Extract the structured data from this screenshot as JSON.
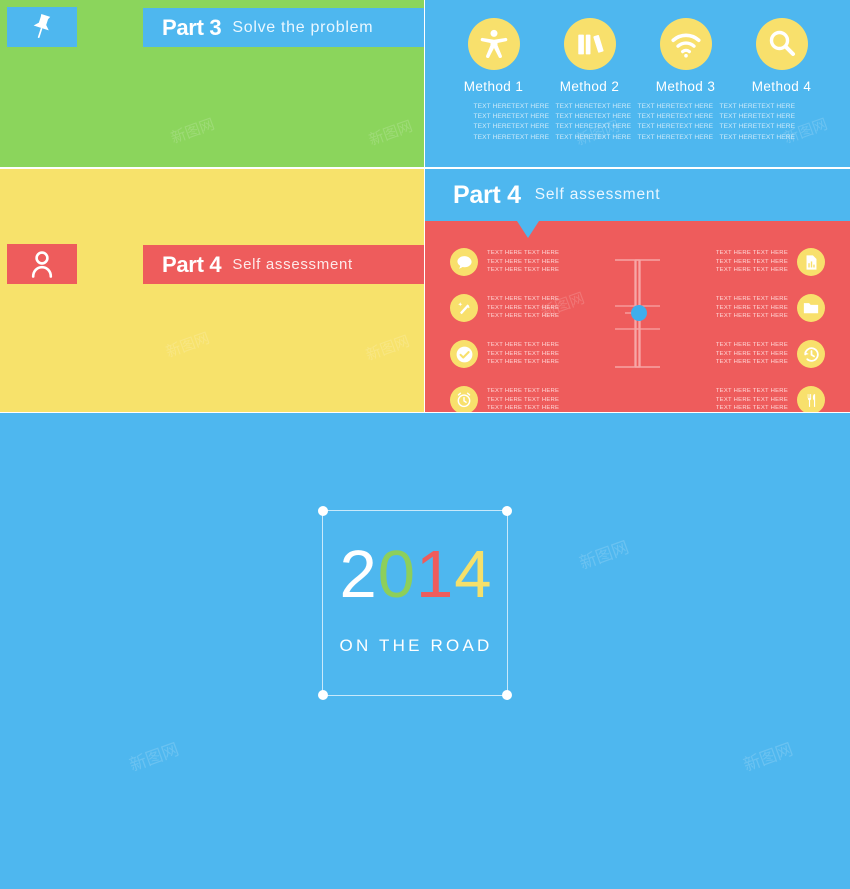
{
  "slide_green": {
    "pin_icon": "pushpin-icon",
    "part_number": "Part 3",
    "part_subtitle": "Solve the problem",
    "bar_color": "#4EB7EF",
    "bg_color": "#8BD55C"
  },
  "slide_methods": {
    "bg_color": "#4EB7EF",
    "icon_circle_color": "#F8E06C",
    "methods": [
      {
        "icon": "person-accessibility-icon",
        "label": "Method 1"
      },
      {
        "icon": "books-icon",
        "label": "Method 2"
      },
      {
        "icon": "wifi-icon",
        "label": "Method 3"
      },
      {
        "icon": "magnifier-icon",
        "label": "Method 4"
      }
    ],
    "body_columns": [
      [
        "TEXT HERETEXT HERE",
        "TEXT HERETEXT HERE",
        "TEXT HERETEXT HERE",
        "TEXT HERETEXT HERE"
      ],
      [
        "TEXT HERETEXT HERE",
        "TEXT HERETEXT HERE",
        "TEXT HERETEXT HERE",
        "TEXT HERETEXT HERE"
      ],
      [
        "TEXT HERETEXT HERE",
        "TEXT HERETEXT HERE",
        "TEXT HERETEXT HERE",
        "TEXT HERETEXT HERE"
      ],
      [
        "TEXT HERETEXT HERE",
        "TEXT HERETEXT HERE",
        "TEXT HERETEXT HERE",
        "TEXT HERETEXT HERE"
      ]
    ]
  },
  "slide_yellow": {
    "bg_color": "#F7E26B",
    "person_icon": "person-icon",
    "part_number": "Part 4",
    "part_subtitle": "Self assessment",
    "bar_color": "#EE5C5C"
  },
  "slide_diagram": {
    "bg_color": "#EE5C5C",
    "header_color": "#4EB7EF",
    "header_number": "Part 4",
    "header_subtitle": "Self assessment",
    "center_dot_color": "#3FAEEC",
    "left_nodes": [
      {
        "icon": "speech-bubble-icon",
        "lines": [
          "TEXT HERE  TEXT HERE",
          "TEXT HERE TEXT HERE",
          "TEXT HERE TEXT HERE"
        ]
      },
      {
        "icon": "magic-wand-icon",
        "lines": [
          "TEXT HERE  TEXT HERE",
          "TEXT HERE TEXT HERE",
          "TEXT HERE TEXT HERE"
        ]
      },
      {
        "icon": "check-circle-icon",
        "lines": [
          "TEXT HERE  TEXT HERE",
          "TEXT HERE TEXT HERE",
          "TEXT HERE TEXT HERE"
        ]
      },
      {
        "icon": "alarm-clock-icon",
        "lines": [
          "TEXT HERE  TEXT HERE",
          "TEXT HERE TEXT HERE",
          "TEXT HERE TEXT HERE"
        ]
      }
    ],
    "right_nodes": [
      {
        "icon": "report-document-icon",
        "lines": [
          "TEXT HERE  TEXT HERE",
          "TEXT HERE TEXT HERE",
          "TEXT HERE TEXT HERE"
        ]
      },
      {
        "icon": "folder-icon",
        "lines": [
          "TEXT HERE  TEXT HERE",
          "TEXT HERE TEXT HERE",
          "TEXT HERE TEXT HERE"
        ]
      },
      {
        "icon": "history-clock-icon",
        "lines": [
          "TEXT HERE  TEXT HERE",
          "TEXT HERE TEXT HERE",
          "TEXT HERE TEXT HERE"
        ]
      },
      {
        "icon": "cutlery-icon",
        "lines": [
          "TEXT HERE  TEXT HERE",
          "TEXT HERE TEXT HERE",
          "TEXT HERE TEXT HERE"
        ]
      }
    ]
  },
  "slide_cover": {
    "bg_color": "#4EB7EF",
    "frame_border_color": "#C8E9FB",
    "corner_dot_color": "#FFFFFF",
    "year_digits": [
      {
        "char": "2",
        "color": "#FFFFFF"
      },
      {
        "char": "0",
        "color": "#8DCF5A"
      },
      {
        "char": "1",
        "color": "#EE5C5C"
      },
      {
        "char": "4",
        "color": "#F5E06A"
      }
    ],
    "tagline": "ON THE ROAD"
  },
  "watermarks": [
    "新图网",
    "新图网",
    "新图网",
    "新图网",
    "新图网",
    "新图网",
    "新图网"
  ]
}
